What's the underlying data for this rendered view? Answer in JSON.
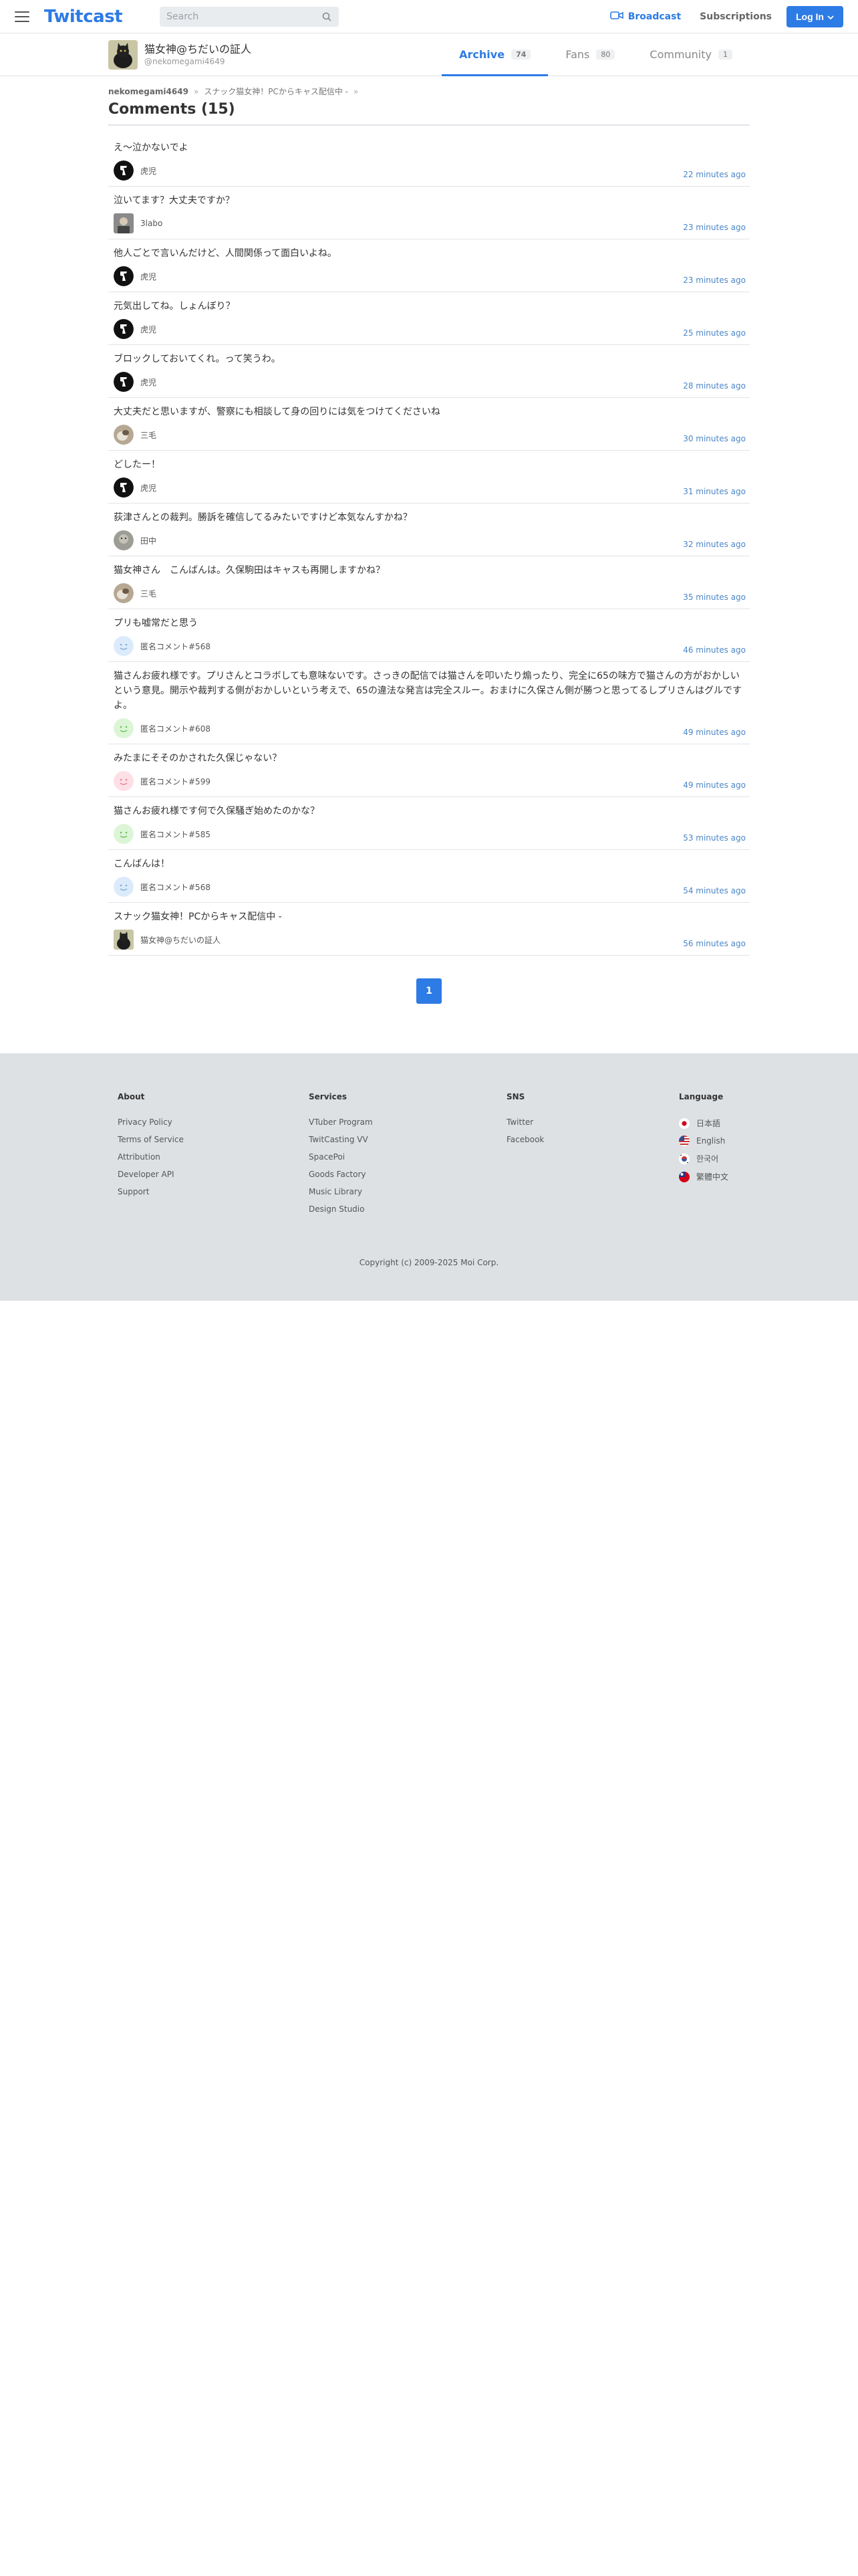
{
  "header": {
    "logo": "Twitcast",
    "search_placeholder": "Search",
    "broadcast": "Broadcast",
    "subscriptions": "Subscriptions",
    "login": "Log In"
  },
  "profile": {
    "name": "猫女神@ちだいの証人",
    "id": "@nekomegami4649",
    "tabs": [
      {
        "label": "Archive",
        "count": "74"
      },
      {
        "label": "Fans",
        "count": "80"
      },
      {
        "label": "Community",
        "count": "1"
      }
    ]
  },
  "breadcrumb": {
    "user": "nekomegami4649",
    "movie": "スナック猫女神！PCからキャス配信中 -"
  },
  "page_title": "Comments (15)",
  "comments": [
    {
      "text": "え～泣かないでよ",
      "user": "虎児",
      "time": "22 minutes ago",
      "avatar": "tora"
    },
    {
      "text": "泣いてます？大丈夫ですか？",
      "user": "3labo",
      "time": "23 minutes ago",
      "avatar": "labo"
    },
    {
      "text": "他人ごとで言いんだけど、人間関係って面白いよね。",
      "user": "虎児",
      "time": "23 minutes ago",
      "avatar": "tora"
    },
    {
      "text": "元気出してね。しょんぼり？",
      "user": "虎児",
      "time": "25 minutes ago",
      "avatar": "tora"
    },
    {
      "text": "ブロックしておいてくれ。って笑うわ。",
      "user": "虎児",
      "time": "28 minutes ago",
      "avatar": "tora"
    },
    {
      "text": "大丈夫だと思いますが、警察にも相談して身の回りには気をつけてくださいね",
      "user": "三毛",
      "time": "30 minutes ago",
      "avatar": "mike"
    },
    {
      "text": "どしたー！",
      "user": "虎児",
      "time": "31 minutes ago",
      "avatar": "tora"
    },
    {
      "text": "荻津さんとの裁判。勝訴を確信してるみたいですけど本気なんすかね？",
      "user": "田中",
      "time": "32 minutes ago",
      "avatar": "tanaka"
    },
    {
      "text": "猫女神さん　こんばんは。久保駒田はキャスも再開しますかね？",
      "user": "三毛",
      "time": "35 minutes ago",
      "avatar": "mike"
    },
    {
      "text": "プリも嘘常だと思う",
      "user": "匿名コメント#568",
      "time": "46 minutes ago",
      "avatar": "anon-blue"
    },
    {
      "text": "猫さんお疲れ様です。プリさんとコラボしても意味ないです。さっきの配信では猫さんを叩いたり煽ったり、完全に65の味方で猫さんの方がおかしいという意見。開示や裁判する側がおかしいという考えで、65の違法な発言は完全スルー。おまけに久保さん側が勝つと思ってるしプリさんはグルですよ。",
      "user": "匿名コメント#608",
      "time": "49 minutes ago",
      "avatar": "anon-green"
    },
    {
      "text": "みたまにそそのかされた久保じゃない？",
      "user": "匿名コメント#599",
      "time": "49 minutes ago",
      "avatar": "anon-pink"
    },
    {
      "text": "猫さんお疲れ様です何で久保騒ぎ始めたのかな？",
      "user": "匿名コメント#585",
      "time": "53 minutes ago",
      "avatar": "anon-green"
    },
    {
      "text": "こんばんは！",
      "user": "匿名コメント#568",
      "time": "54 minutes ago",
      "avatar": "anon-blue"
    },
    {
      "text": "スナック猫女神！PCからキャス配信中 -",
      "user": "猫女神@ちだいの証人",
      "time": "56 minutes ago",
      "avatar": "owner"
    }
  ],
  "pager": {
    "current": "1"
  },
  "footer": {
    "about": {
      "title": "About",
      "links": [
        "Privacy Policy",
        "Terms of Service",
        "Attribution",
        "Developer API",
        "Support"
      ]
    },
    "services": {
      "title": "Services",
      "links": [
        "VTuber Program",
        "TwitCasting VV",
        "SpacePoi",
        "Goods Factory",
        "Music Library",
        "Design Studio"
      ]
    },
    "sns": {
      "title": "SNS",
      "links": [
        "Twitter",
        "Facebook"
      ]
    },
    "language": {
      "title": "Language",
      "items": [
        {
          "label": "日本語",
          "flag": "jp"
        },
        {
          "label": "English",
          "flag": "us"
        },
        {
          "label": "한국어",
          "flag": "kr"
        },
        {
          "label": "繁體中文",
          "flag": "tw"
        }
      ]
    },
    "copyright": "Copyright (c) 2009-2025 Moi Corp."
  },
  "colors": {
    "accent": "#2d7be5",
    "time": "#4a86c8",
    "footer_bg": "#dee1e4"
  }
}
